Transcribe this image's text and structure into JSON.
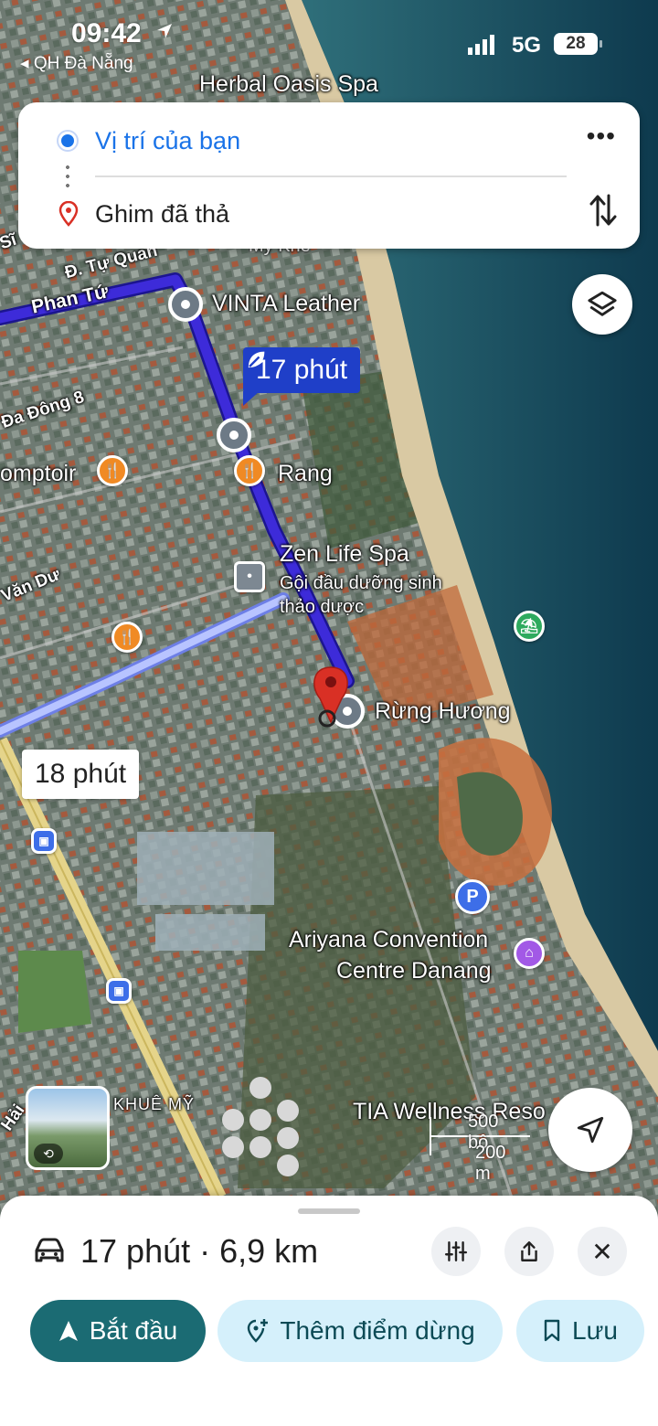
{
  "status_bar": {
    "time": "09:42",
    "back_app": "◂ QH Đà Nẵng",
    "network": "5G",
    "battery": "28"
  },
  "directions": {
    "origin": "Vị trí của bạn",
    "destination": "Ghim đã thả",
    "more_glyph": "•••",
    "swap_icon": "swap-vertical-icon"
  },
  "map": {
    "route_time_primary": "17 phút",
    "route_time_alternate": "18 phút",
    "places": {
      "herbal": "Herbal Oasis Spa",
      "vinta": "VINTA Leather",
      "rang": "Rang",
      "comptoir": "omptoir",
      "zen": "Zen Life Spa",
      "zen_sub1": "Gội đầu dưỡng sinh",
      "zen_sub2": "thảo dược",
      "rung_huong": "Rừng Hương",
      "ariyana1": "Ariyana Convention",
      "ariyana2": "Centre Danang",
      "tia": "TIA Wellness Reso",
      "khue_my": "KHUÊ MỸ",
      "my_khe": "Mỹ Khê"
    },
    "streets": {
      "tu_quan": "Đ. Tự Quan",
      "phan_tu": "Phan Tứ",
      "da_dong": "Đa Đông 8",
      "van_du": "Văn Dư",
      "si": "Sĩ",
      "hai": "Hải"
    },
    "scale": {
      "feet": "500 bộ",
      "meters": "200 m"
    },
    "parking_glyph": "P"
  },
  "sheet": {
    "summary": "17 phút · 6,9 km",
    "close_glyph": "✕",
    "start_label": "Bắt đầu",
    "add_stop_label": "Thêm điểm dừng",
    "save_label": "Lưu"
  },
  "colors": {
    "route": "#3d2bd9",
    "route_alt": "#a8b8ff",
    "primary_button": "#1b6b73",
    "secondary_button": "#d5f0fb",
    "accent_blue": "#1a73e8",
    "pin_red": "#d93025"
  }
}
